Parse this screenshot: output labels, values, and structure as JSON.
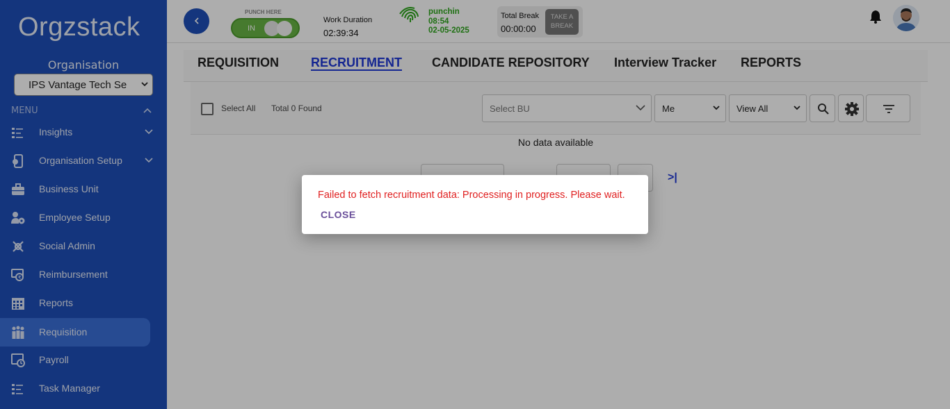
{
  "brand": {
    "logo_text": "Orgzstack",
    "accent": "#1e4fb8",
    "active_tab_color": "#1f38d6",
    "error_color": "#e02020"
  },
  "sidebar": {
    "org_label": "Organisation",
    "org_selected": "IPS Vantage Tech Se",
    "menu_label": "MENU",
    "items": [
      {
        "label": "Insights",
        "icon": "list-icon",
        "has_submenu": true
      },
      {
        "label": "Organisation Setup",
        "icon": "org-setup-icon",
        "has_submenu": true
      },
      {
        "label": "Business Unit",
        "icon": "briefcase-icon",
        "has_submenu": false
      },
      {
        "label": "Employee Setup",
        "icon": "employee-gear-icon",
        "has_submenu": false
      },
      {
        "label": "Social Admin",
        "icon": "social-icon",
        "has_submenu": false
      },
      {
        "label": "Reimbursement",
        "icon": "reimbursement-icon",
        "has_submenu": false
      },
      {
        "label": "Reports",
        "icon": "calendar-grid-icon",
        "has_submenu": false
      },
      {
        "label": "Requisition",
        "icon": "people-icon",
        "has_submenu": false,
        "active": true
      },
      {
        "label": "Payroll",
        "icon": "payroll-icon",
        "has_submenu": false
      },
      {
        "label": "Task Manager",
        "icon": "tasks-icon",
        "has_submenu": false
      }
    ]
  },
  "topbar": {
    "back_icon": "chevron-left-icon",
    "punch_caption": "PUNCH HERE",
    "punch_state": "IN",
    "work_duration_label": "Work Duration",
    "work_duration_value": "02:39:34",
    "punch_status": "punchin",
    "punch_time": "08:54",
    "punch_date": "02-05-2025",
    "total_break_label": "Total Break",
    "total_break_value": "00:00:00",
    "take_break_label_1": "TAKE A",
    "take_break_label_2": "BREAK"
  },
  "tabs": [
    {
      "label": "REQUISITION",
      "active": false
    },
    {
      "label": "RECRUITMENT",
      "active": true
    },
    {
      "label": "CANDIDATE REPOSITORY",
      "active": false
    },
    {
      "label": "Interview Tracker",
      "active": false
    },
    {
      "label": "REPORTS",
      "active": false
    }
  ],
  "toolbar": {
    "select_all_label": "Select All",
    "total_found": "Total 0 Found",
    "bu_placeholder": "Select BU",
    "owner_value": "Me",
    "view_value": "View All"
  },
  "table": {
    "empty_text": "No data available"
  },
  "pagination": {
    "last_icon": ">|"
  },
  "dialog": {
    "message": "Failed to fetch recruitment data: Processing in progress. Please wait.",
    "close_label": "CLOSE"
  }
}
